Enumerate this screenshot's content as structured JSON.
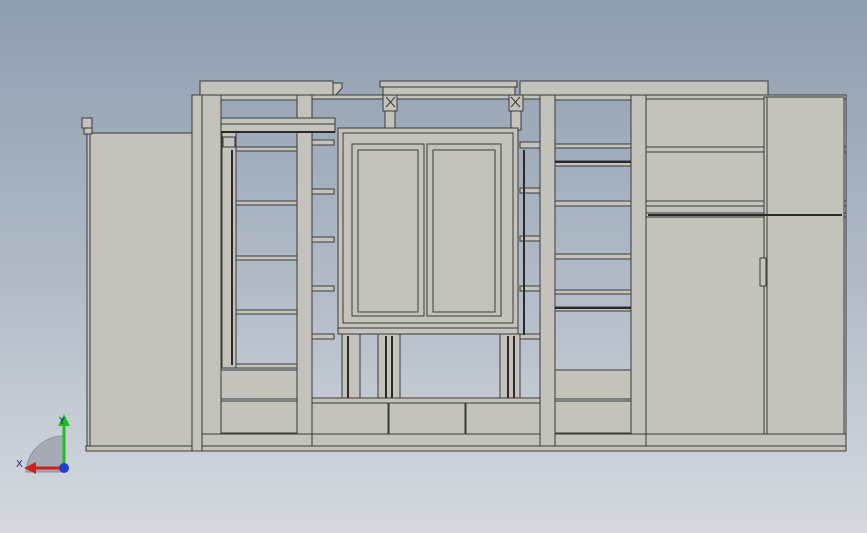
{
  "viewport": {
    "background_top": "#8e9db0",
    "background_bottom": "#d6dae0"
  },
  "model": {
    "fill": "#c3c3bb",
    "edge": "#3a3a38",
    "shadow": "#8d8d86"
  },
  "triad": {
    "x_label": "X",
    "y_label": "Y",
    "x_color": "#d41e1e",
    "y_color": "#1fbf1f",
    "z_color": "#1f3ed4"
  }
}
